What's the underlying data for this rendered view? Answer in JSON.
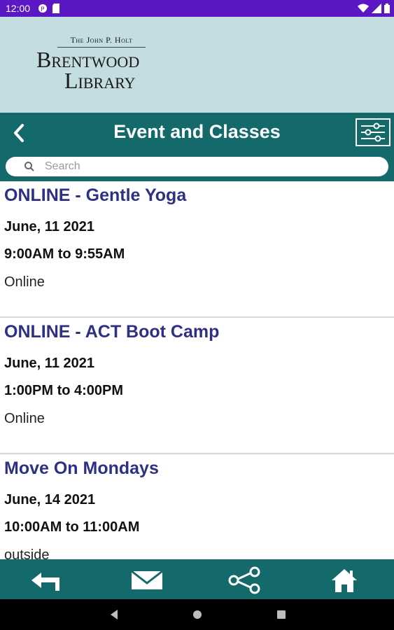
{
  "status_bar": {
    "time": "12:00",
    "color": "#5c17c4"
  },
  "logo": {
    "line_top": "The John P. Holt",
    "line1": "Brentwood",
    "line2": "Library"
  },
  "header": {
    "title": "Event and Classes",
    "color": "#146a6b"
  },
  "search": {
    "placeholder": "Search",
    "value": ""
  },
  "events": [
    {
      "title": "ONLINE - Gentle Yoga",
      "date": "June, 11 2021",
      "time": "9:00AM to 9:55AM",
      "location": "Online"
    },
    {
      "title": "ONLINE - ACT Boot Camp",
      "date": "June, 11 2021",
      "time": "1:00PM to 4:00PM",
      "location": "Online"
    },
    {
      "title": "Move On Mondays",
      "date": "June, 14 2021",
      "time": "10:00AM to 11:00AM",
      "location": "outside"
    }
  ],
  "toolbar": {
    "icons": [
      "reply-icon",
      "mail-icon",
      "share-icon",
      "home-icon"
    ]
  },
  "colors": {
    "accent": "#146a6b",
    "logo_bg": "#c3dde0",
    "event_title": "#2e3183"
  }
}
